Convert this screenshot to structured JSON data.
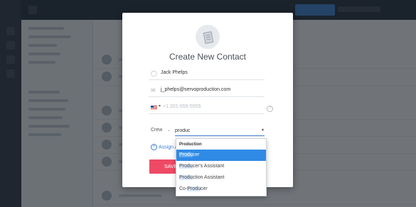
{
  "modal": {
    "title": "Create New Contact",
    "fields": {
      "name_value": "Jack Phelps",
      "email_value": "j_phelps@servoproduction.com",
      "phone_placeholder": "+1 201-555-5555"
    },
    "role": {
      "label": "Crew",
      "search_value": "produc"
    },
    "assign_link": "Assign An",
    "save_button": "SAVE"
  },
  "dropdown": {
    "group": "Production",
    "match": "Produ",
    "options": [
      {
        "prefix": "",
        "match": "Produ",
        "suffix": "cer",
        "selected": true
      },
      {
        "prefix": "",
        "match": "Produ",
        "suffix": "cer's Assistant",
        "selected": false
      },
      {
        "prefix": "",
        "match": "Produ",
        "suffix": "ction Assistant",
        "selected": false
      },
      {
        "prefix": "Co-",
        "match": "Produ",
        "suffix": "cer",
        "selected": false
      }
    ]
  },
  "icons": {
    "name_field": "person-icon",
    "email_field": "envelope-icon",
    "phone_field": "us-flag-icon",
    "help": "question-icon",
    "avatar": "contact-card-icon"
  },
  "colors": {
    "accent": "#3b7ed0",
    "save": "#ee4a65",
    "selected_option": "#2f8ae6"
  }
}
